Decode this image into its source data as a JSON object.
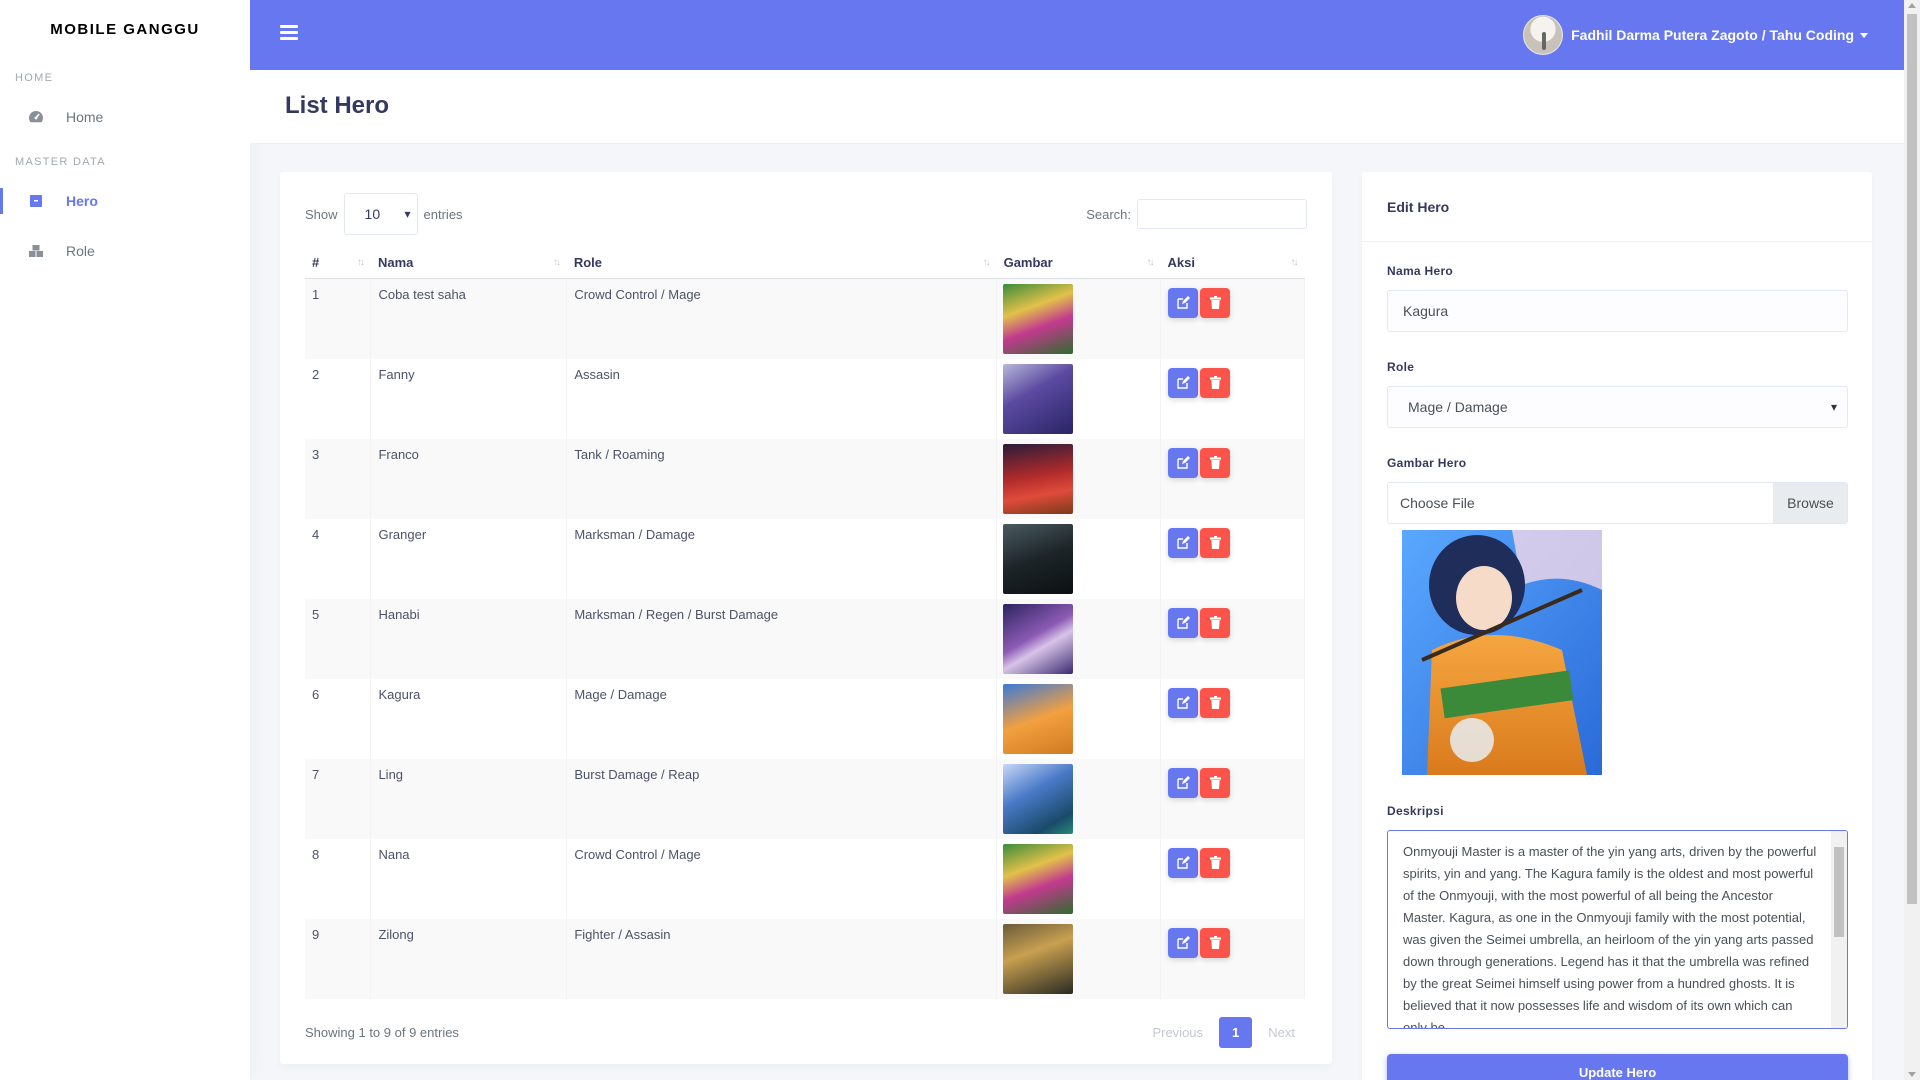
{
  "brand": "MOBILE GANGGU",
  "sidebar": {
    "sections": [
      {
        "header": "HOME",
        "items": [
          {
            "label": "Home",
            "icon": "tachometer-icon"
          }
        ]
      },
      {
        "header": "MASTER DATA",
        "items": [
          {
            "label": "Hero",
            "icon": "box-icon"
          },
          {
            "label": "Role",
            "icon": "boxes-icon"
          }
        ]
      }
    ]
  },
  "navbar": {
    "user": "Fadhil Darma Putera Zagoto / Tahu Coding"
  },
  "page": {
    "title": "List Hero"
  },
  "table": {
    "show_label": "Show",
    "entries_value": "10",
    "entries_label": "entries",
    "search_label": "Search:",
    "columns": [
      "#",
      "Nama",
      "Role",
      "Gambar",
      "Aksi"
    ],
    "rows": [
      {
        "no": "1",
        "nama": "Coba test saha",
        "role": "Crowd Control / Mage"
      },
      {
        "no": "2",
        "nama": "Fanny",
        "role": "Assasin"
      },
      {
        "no": "3",
        "nama": "Franco",
        "role": "Tank / Roaming"
      },
      {
        "no": "4",
        "nama": "Granger",
        "role": "Marksman / Damage"
      },
      {
        "no": "5",
        "nama": "Hanabi",
        "role": "Marksman / Regen / Burst Damage"
      },
      {
        "no": "6",
        "nama": "Kagura",
        "role": "Mage / Damage"
      },
      {
        "no": "7",
        "nama": "Ling",
        "role": "Burst Damage / Reap"
      },
      {
        "no": "8",
        "nama": "Nana",
        "role": "Crowd Control / Mage"
      },
      {
        "no": "9",
        "nama": "Zilong",
        "role": "Fighter / Assasin"
      }
    ],
    "info": "Showing 1 to 9 of 9 entries",
    "pagination": {
      "previous": "Previous",
      "current": "1",
      "next": "Next"
    }
  },
  "edit": {
    "title": "Edit Hero",
    "nama_label": "Nama Hero",
    "nama_value": "Kagura",
    "role_label": "Role",
    "role_value": "Mage / Damage",
    "gambar_label": "Gambar Hero",
    "file_placeholder": "Choose File",
    "browse_label": "Browse",
    "deskripsi_label": "Deskripsi",
    "deskripsi_value": "Onmyouji Master is a master of the yin yang arts, driven by the powerful spirits, yin and yang. The Kagura family is the oldest and most powerful of the Onmyouji, with the most powerful of all being the Ancestor Master. Kagura, as one in the Onmyouji family with the most potential, was given the Seimei umbrella, an heirloom of the yin yang arts passed down through generations. Legend has it that the umbrella was refined by the great Seimei himself using power from a hundred ghosts. It is believed that it now possesses life and wisdom of its own which can only be",
    "submit_label": "Update Hero"
  },
  "colors": {
    "primary": "#6777ef",
    "danger": "#fc544b"
  }
}
